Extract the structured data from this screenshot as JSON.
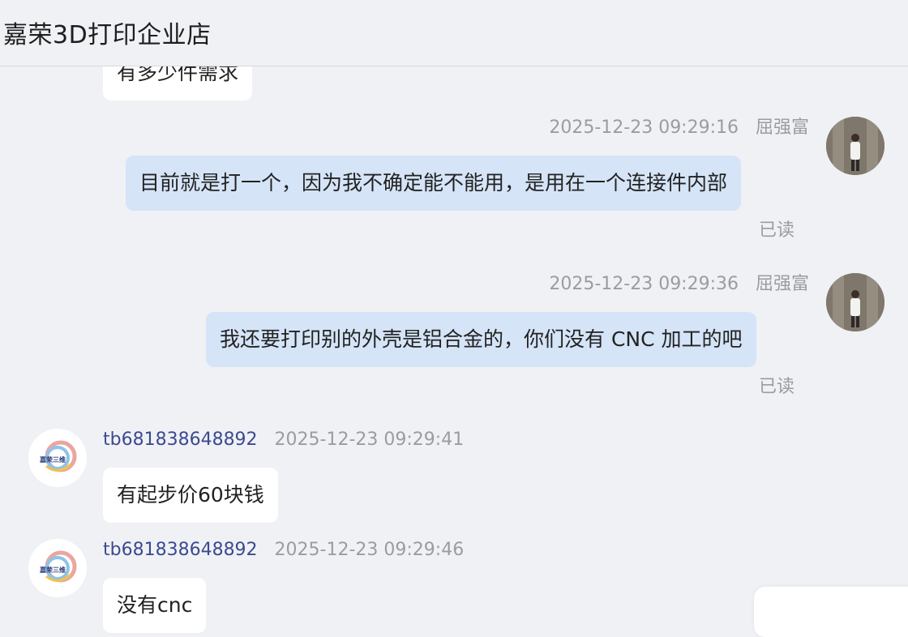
{
  "header": {
    "title": "嘉荣3D打印企业店"
  },
  "messages": [
    {
      "direction": "in",
      "text": "有多少件需求"
    },
    {
      "direction": "out",
      "sender": "屈强富",
      "time": "2025-12-23 09:29:16",
      "text": "目前就是打一个，因为我不确定能不能用，是用在一个连接件内部",
      "status": "已读"
    },
    {
      "direction": "out",
      "sender": "屈强富",
      "time": "2025-12-23 09:29:36",
      "text": "我还要打印别的外壳是铝合金的，你们没有 CNC 加工的吧",
      "status": "已读"
    },
    {
      "direction": "in",
      "sender": "tb681838648892",
      "time": "2025-12-23 09:29:41",
      "text": "有起步价60块钱"
    },
    {
      "direction": "in",
      "sender": "tb681838648892",
      "time": "2025-12-23 09:29:46",
      "text": "没有cnc"
    }
  ],
  "shop_avatar": {
    "label": "嘉荣三维",
    "icon": "shop-logo-icon"
  },
  "user_avatar": {
    "icon": "user-avatar-icon"
  },
  "colors": {
    "background": "#f0f1f5",
    "outgoing_bubble": "#d5e4f7",
    "incoming_bubble": "#ffffff",
    "sender_name": "#3c4a8f",
    "meta_text": "#9a9ca1"
  }
}
